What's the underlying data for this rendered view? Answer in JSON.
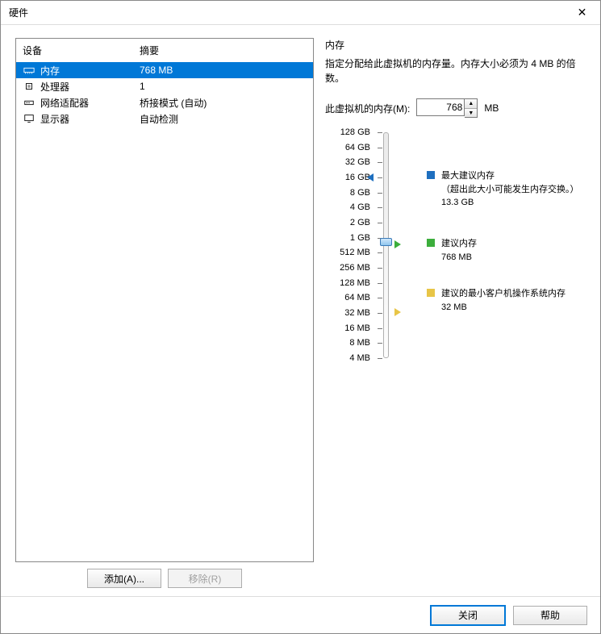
{
  "title": "硬件",
  "columns": {
    "device": "设备",
    "summary": "摘要"
  },
  "devices": [
    {
      "name": "内存",
      "summary": "768 MB",
      "icon": "memory",
      "selected": true
    },
    {
      "name": "处理器",
      "summary": "1",
      "icon": "cpu",
      "selected": false
    },
    {
      "name": "网络适配器",
      "summary": "桥接模式 (自动)",
      "icon": "network",
      "selected": false
    },
    {
      "name": "显示器",
      "summary": "自动检测",
      "icon": "display",
      "selected": false
    }
  ],
  "buttons": {
    "add": "添加(A)...",
    "remove": "移除(R)",
    "close": "关闭",
    "help": "帮助"
  },
  "memory": {
    "group_title": "内存",
    "hint": "指定分配给此虚拟机的内存量。内存大小必须为 4 MB 的倍数。",
    "field_label": "此虚拟机的内存(M):",
    "value": "768",
    "unit": "MB",
    "ticks": [
      "128 GB",
      "64 GB",
      "32 GB",
      "16 GB",
      "8 GB",
      "4 GB",
      "2 GB",
      "1 GB",
      "512 MB",
      "256 MB",
      "128 MB",
      "64 MB",
      "32 MB",
      "16 MB",
      "8 MB",
      "4 MB"
    ],
    "legend": {
      "max": {
        "title": "最大建议内存",
        "note": "（超出此大小可能发生内存交换。）",
        "value": "13.3 GB",
        "color": "#1e6fbf"
      },
      "rec": {
        "title": "建议内存",
        "value": "768 MB",
        "color": "#3cae3c"
      },
      "min": {
        "title": "建议的最小客户机操作系统内存",
        "value": "32 MB",
        "color": "#e8c547"
      }
    }
  }
}
